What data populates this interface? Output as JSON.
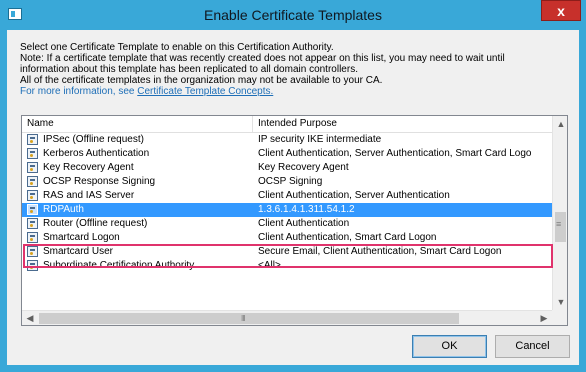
{
  "window": {
    "title": "Enable Certificate Templates",
    "close_glyph": "x"
  },
  "description": {
    "line1": "Select one Certificate Template to enable on this Certification Authority.",
    "line2": "Note: If a certificate template that was recently created does not appear on this list, you may need to wait until",
    "line3": "information about this template has been replicated to all domain controllers.",
    "line4": "All of the certificate templates in the organization may not be available to your CA.",
    "more_info_prefix": "For more information, see ",
    "more_info_link": "Certificate Template Concepts."
  },
  "table": {
    "columns": [
      "Name",
      "Intended Purpose"
    ],
    "rows": [
      {
        "name": "IPSec (Offline request)",
        "purpose": "IP security IKE intermediate"
      },
      {
        "name": "Kerberos Authentication",
        "purpose": "Client Authentication, Server Authentication, Smart Card Logo"
      },
      {
        "name": "Key Recovery Agent",
        "purpose": "Key Recovery Agent"
      },
      {
        "name": "OCSP Response Signing",
        "purpose": "OCSP Signing"
      },
      {
        "name": "RAS and IAS Server",
        "purpose": "Client Authentication, Server Authentication"
      },
      {
        "name": "RDPAuth",
        "purpose": "1.3.6.1.4.1.311.54.1.2"
      },
      {
        "name": "Router (Offline request)",
        "purpose": "Client Authentication"
      },
      {
        "name": "Smartcard Logon",
        "purpose": "Client Authentication, Smart Card Logon"
      },
      {
        "name": "Smartcard User",
        "purpose": "Secure Email, Client Authentication, Smart Card Logon"
      },
      {
        "name": "Subordinate Certification Authority",
        "purpose": "<All>"
      }
    ],
    "selected_row": "RDPAuth"
  },
  "buttons": {
    "ok": "OK",
    "cancel": "Cancel"
  },
  "colors": {
    "title_bar": "#39a8d8",
    "close_button": "#c7302b",
    "selection": "#3399ff",
    "highlight_box": "#e0336c",
    "link": "#1f6fb7"
  },
  "icons": {
    "window": "certificate-window-icon",
    "row": "certificate-template-icon",
    "close": "close-icon"
  }
}
